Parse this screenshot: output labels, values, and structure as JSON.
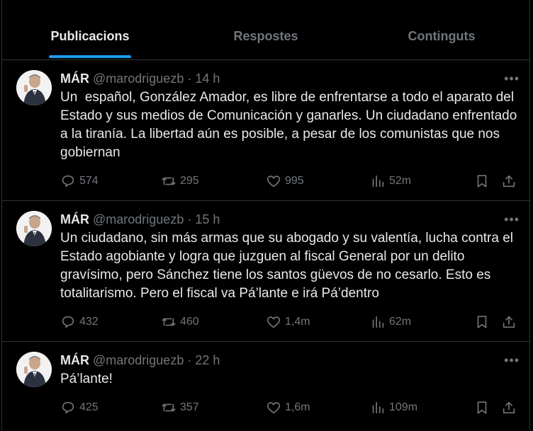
{
  "tabs": [
    {
      "label": "Publicacions",
      "active": true
    },
    {
      "label": "Respostes",
      "active": false
    },
    {
      "label": "Continguts",
      "active": false
    }
  ],
  "posts": [
    {
      "name": "MÁR",
      "handle": "@marodriguezb",
      "dot": "·",
      "time": "14 h",
      "text": "Un  español, González Amador, es libre de enfrentarse a todo el aparato del Estado y sus medios de Comunicación y ganarles. Un ciudadano enfrentado a la tiranía. La libertad aún es posible, a pesar de los comunistas que nos gobiernan",
      "replies": "574",
      "reposts": "295",
      "likes": "995",
      "views": "52m"
    },
    {
      "name": "MÁR",
      "handle": "@marodriguezb",
      "dot": "·",
      "time": "15 h",
      "text": "Un ciudadano, sin más armas que su abogado y su valentía, lucha contra el Estado agobiante y logra que juzguen al fiscal General por un delito gravísimo, pero Sánchez tiene los santos güevos de no cesarlo. Esto es totalitarismo. Pero el fiscal va Pá’lante e irá Pá’dentro",
      "replies": "432",
      "reposts": "460",
      "likes": "1,4m",
      "views": "62m"
    },
    {
      "name": "MÁR",
      "handle": "@marodriguezb",
      "dot": "·",
      "time": "22 h",
      "text": "Pá’lante!",
      "replies": "425",
      "reposts": "357",
      "likes": "1,6m",
      "views": "109m"
    }
  ],
  "more_label": "•••",
  "colors": {
    "accent": "#1d9bf0",
    "muted": "#71767b",
    "text": "#e7e9ea",
    "border": "#2f3336",
    "background": "#000000"
  },
  "icons": [
    "reply-icon",
    "repost-icon",
    "like-icon",
    "views-icon",
    "bookmark-icon",
    "share-icon",
    "more-icon",
    "avatar"
  ]
}
